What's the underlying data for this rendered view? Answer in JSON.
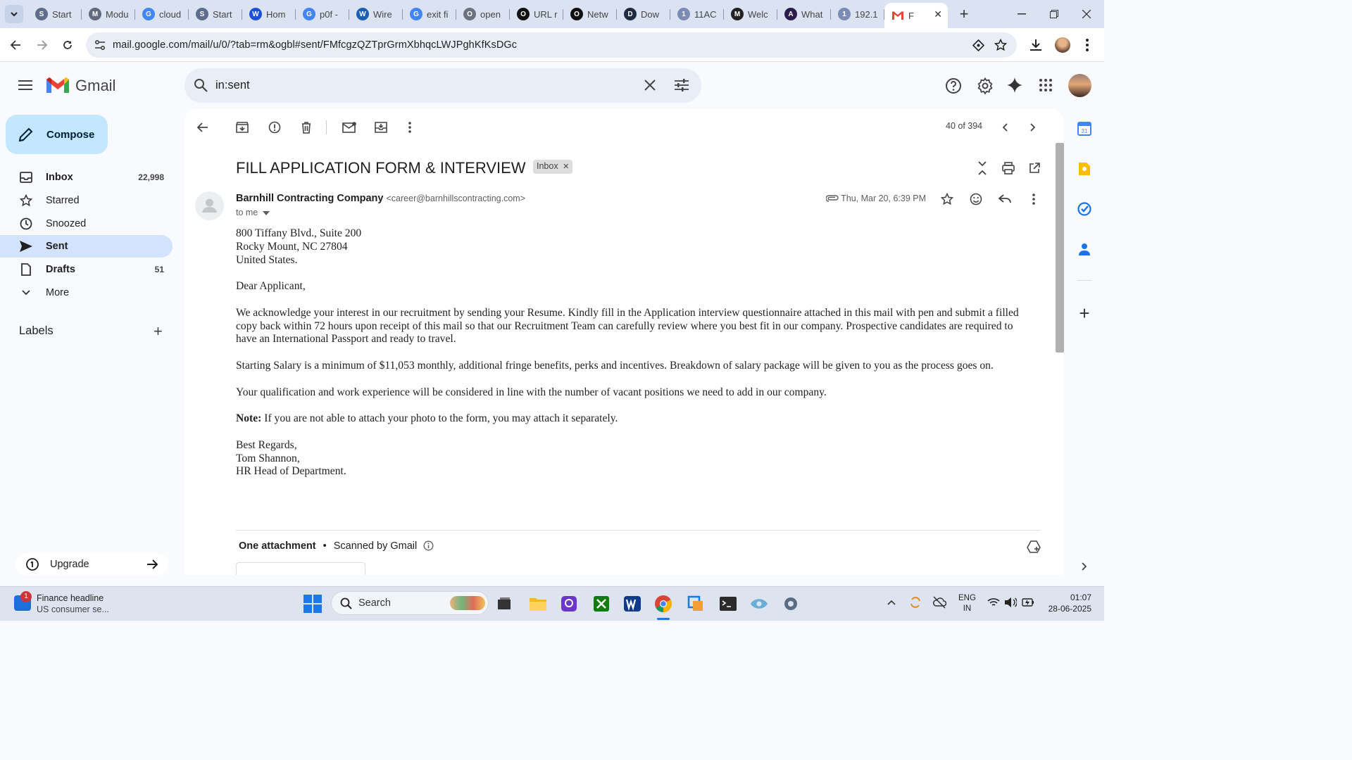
{
  "browser": {
    "tabs": [
      {
        "label": "Start",
        "color": "#5f6d8c",
        "letter": "S"
      },
      {
        "label": "Modu",
        "color": "#606a7c",
        "letter": "M"
      },
      {
        "label": "cloud",
        "color": "#4285f4",
        "letter": "G"
      },
      {
        "label": "Start",
        "color": "#5f6d8c",
        "letter": "S"
      },
      {
        "label": "Hom",
        "color": "#1d4ed8",
        "letter": "W"
      },
      {
        "label": "p0f -",
        "color": "#4285f4",
        "letter": "G"
      },
      {
        "label": "Wire",
        "color": "#1a5fb4",
        "letter": "W"
      },
      {
        "label": "exit fi",
        "color": "#4285f4",
        "letter": "G"
      },
      {
        "label": "open",
        "color": "#6b7280",
        "letter": "O"
      },
      {
        "label": "URL r",
        "color": "#111111",
        "letter": "O"
      },
      {
        "label": "Netw",
        "color": "#111111",
        "letter": "O"
      },
      {
        "label": "Dow",
        "color": "#1f2a44",
        "letter": "D"
      },
      {
        "label": "11AC",
        "color": "#7b8bb3",
        "letter": "1"
      },
      {
        "label": "Welc",
        "color": "#222222",
        "letter": "M"
      },
      {
        "label": "What",
        "color": "#2d1b4e",
        "letter": "A"
      },
      {
        "label": "192.1",
        "color": "#7b8bb3",
        "letter": "1"
      }
    ],
    "active_tab": {
      "label": "F",
      "letter": "M"
    },
    "url": "mail.google.com/mail/u/0/?tab=rm&ogbl#sent/FMfcgzQZTprGrmXbhqcLWJPghKfKsDGc"
  },
  "gmail": {
    "logo_text": "Gmail",
    "search_query": "in:sent",
    "compose_label": "Compose",
    "nav": [
      {
        "label": "Inbox",
        "count": "22,998",
        "icon": "inbox-icon"
      },
      {
        "label": "Starred",
        "count": "",
        "icon": "star-icon"
      },
      {
        "label": "Snoozed",
        "count": "",
        "icon": "clock-icon"
      },
      {
        "label": "Sent",
        "count": "",
        "icon": "send-icon"
      },
      {
        "label": "Drafts",
        "count": "51",
        "icon": "draft-icon"
      },
      {
        "label": "More",
        "count": "",
        "icon": "chevron-down-icon"
      }
    ],
    "labels_heading": "Labels",
    "upgrade_label": "Upgrade",
    "pager": "40 of 394"
  },
  "email": {
    "subject": "FILL APPLICATION FORM & INTERVIEW",
    "label_badge": "Inbox",
    "sender_name": "Barnhill Contracting Company",
    "sender_email": "<career@barnhillscontracting.com>",
    "to": "to me",
    "date": "Thu, Mar 20, 6:39 PM",
    "address_lines": [
      "800 Tiffany Blvd., Suite 200",
      "Rocky Mount, NC 27804",
      "United States."
    ],
    "greeting": "Dear Applicant,",
    "para1": "We acknowledge your interest in our recruitment by sending your Resume. Kindly fill in the Application interview questionnaire attached in this mail with pen and submit a filled copy back within 72 hours upon receipt of this mail so that our Recruitment Team can carefully review where you best fit in our company. Prospective candidates are required to have an International Passport and ready to travel.",
    "para2": "Starting Salary is a minimum of $11,053 monthly, additional fringe benefits, perks and incentives. Breakdown of salary package will be given to you as the process goes on.",
    "para3": "Your qualification and work experience will be considered in line with the number of vacant positions we need to add in our company.",
    "note_label": "Note:",
    "note_text": " If you are not able to attach your photo to the form, you may attach it separately.",
    "signoff_lines": [
      "Best Regards,",
      "Tom Shannon,",
      "HR Head of Department."
    ],
    "attachment_title": "One attachment",
    "attachment_scan": "Scanned by Gmail"
  },
  "taskbar": {
    "news_title": "Finance headline",
    "news_sub": "US consumer se...",
    "news_badge": "1",
    "search_placeholder": "Search",
    "lang_top": "ENG",
    "lang_bottom": "IN",
    "time": "01:07",
    "date": "28-06-2025"
  },
  "colors": {
    "gmail_red": "#ea4335",
    "compose_bg": "#c2e7ff",
    "sent_active_bg": "#d3e3fd"
  }
}
